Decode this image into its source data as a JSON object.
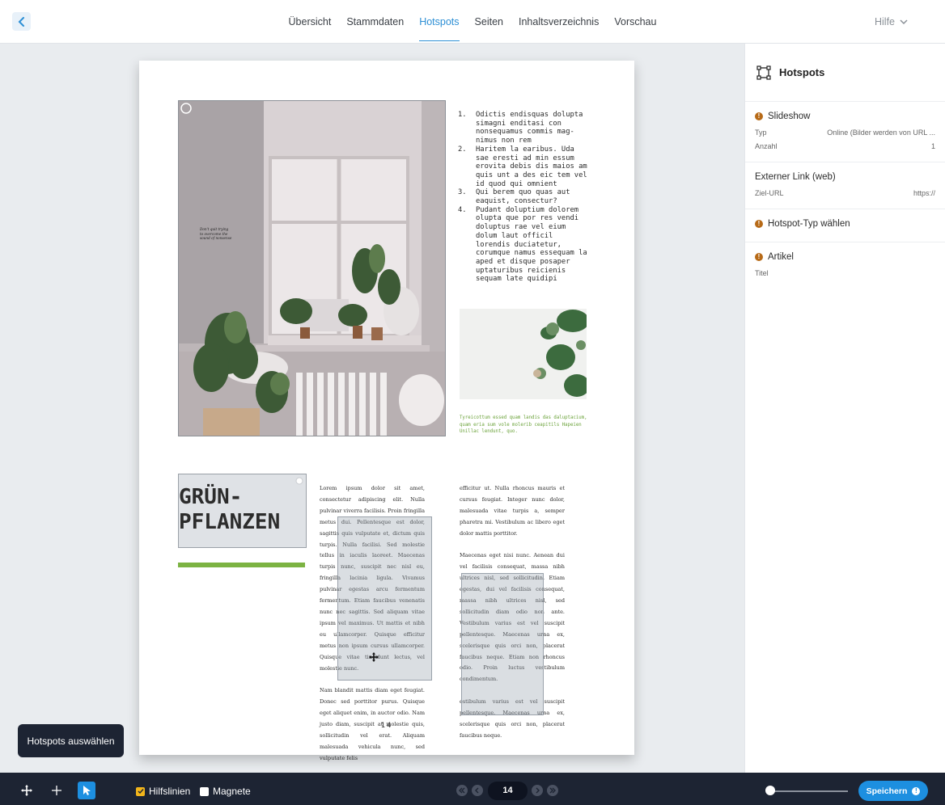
{
  "nav": {
    "tabs": [
      {
        "label": "Übersicht"
      },
      {
        "label": "Stammdaten"
      },
      {
        "label": "Hotspots"
      },
      {
        "label": "Seiten"
      },
      {
        "label": "Inhaltsverzeichnis"
      },
      {
        "label": "Vorschau"
      }
    ],
    "active_tab": "Hotspots",
    "help_label": "Hilfe"
  },
  "page": {
    "numbered_list": [
      {
        "n": "1.",
        "text": "Odictis endisquas dolup­ta simagni enditasi con nonsequamus commis mag­nimus non rem"
      },
      {
        "n": "2.",
        "text": "Haritem la earibus. Uda sae eresti ad min es­sum erovita debis dis maios am quis unt a des eic tem vel id quod qui omnient"
      },
      {
        "n": "3.",
        "text": "Qui berem quo quas aut eaquist, consectur?"
      },
      {
        "n": "4.",
        "text": "Pudant doluptium dolo­rem olupta que por res vendi doluptus rae vel eium dolum laut offi­cil lorendis duciatetur, corumque namus essequam la aped et disque posa­per uptaturibus reicie­nis sequam late quidipi"
      }
    ],
    "green_caption": "Tyreicottum essed quam landis das daluptacium, quam eria sum vole molerib ceapitils Hapeien Unillac lendunt, quo.",
    "title_lines": [
      "GRÜN-",
      "PFLANZEN"
    ],
    "col1_paragraphs": [
      "Lorem ipsum dolor sit amet, consectetur adipiscing elit. Nulla pulvinar viverra facilisis. Proin fringilla metus dui. Pellentesque est dolor, sagittis quis vulputate et, dictum quis turpis. Nulla facilisi. Sed molestie tellus in iaculis laoreet. Maecenas turpis nunc, suscipit nec nisl eu, fringilla lacinia ligula. Vivamus pulvinar egestas arcu fermentum fermentum. Etiam faucibus venenatis nunc nec sagittis. Sed aliquam vitae ipsum vel maximus. Ut mattis et nibh eu ullamcorper. Quisque efficitur metus non ipsum cursus ullamcorper. Quisque vitae tincidunt lectus, vel molestie nunc.",
      "Nam blandit mattis diam eget feugiat. Donec sed porttitor purus. Quisque eget aliquet enim, in auctor odio. Nam justo diam, suscipit at molestie quis, sollicitudin vel erat. Aliquam malesuada vehicula nunc, sed vulputate felis"
    ],
    "col2_paragraphs": [
      "efficitur ut. Nulla rhoncus mauris et cursus feugiat. Integer nunc dolor, malesuada vitae turpis a, semper pharetra mi. Vestibulum ac libero eget dolor mattis porttitor.",
      "Maecenas eget nisi nunc. Aenean dui vel facilisis consequat, massa nibh ultrices nisl, sed sollicitudin. Etiam egestas, dui vel facilisis consequat, massa nibh ultrices nisl, sed sollicitudin diam odio non ante. Vestibulum varius est vel suscipit pellentesque. Maecenas urna ex, scelerisque quis orci non, placerat faucibus neque. Etiam non rhoncus odio. Proin luctus vestibulum condimentum.",
      "estibulum varius est vel suscipit pellentesque. Maecenas urna ex, scelerisque quis orci non, placerat faucibus neque."
    ],
    "page_number": "14",
    "doodle_text": "Don't quit trying to overcome the sound of nonsense"
  },
  "tooltip": "Hotspots auswählen",
  "panel": {
    "title": "Hotspots",
    "sections": [
      {
        "title": "Slideshow",
        "warn": true,
        "rows": [
          {
            "k": "Typ",
            "v": "Online (Bilder werden von URL ..."
          },
          {
            "k": "Anzahl",
            "v": "1"
          }
        ]
      },
      {
        "title": "Externer Link (web)",
        "warn": false,
        "rows": [
          {
            "k": "Ziel-URL",
            "v": "https://"
          }
        ]
      },
      {
        "title": "Hotspot-Typ wählen",
        "warn": true,
        "rows": []
      },
      {
        "title": "Artikel",
        "warn": true,
        "rows": [
          {
            "k": "Titel",
            "v": ""
          }
        ]
      }
    ]
  },
  "bottom": {
    "guides_label": "Hilfslinien",
    "guides_checked": true,
    "magnets_label": "Magnete",
    "magnets_checked": false,
    "current_page": "14",
    "save_label": "Speichern",
    "zoom_level": 0.0
  },
  "colors": {
    "accent": "#2d8fd5",
    "bottom_bar": "#1d2433",
    "green_bar": "#7cb342",
    "warn": "#b76a17",
    "save_button": "#1d8fe0"
  }
}
